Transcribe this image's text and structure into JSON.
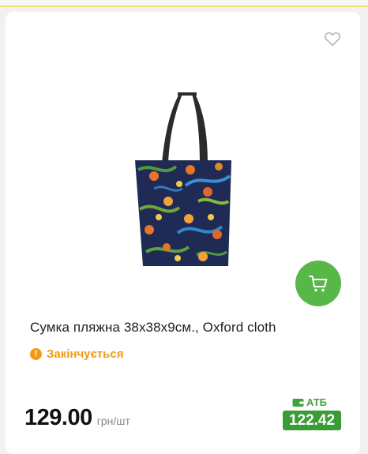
{
  "product": {
    "title": "Сумка пляжна 38х38х9см., Oxford cloth",
    "status": "Закінчується",
    "price": "129.00",
    "price_unit": "грн/шт",
    "card_label": "АТБ",
    "card_price": "122.42"
  },
  "icons": {
    "favorite": "heart-icon",
    "cart": "shopping-cart-icon",
    "status": "exclamation-icon",
    "card": "wallet-icon"
  },
  "colors": {
    "accent_green": "#57b847",
    "card_price_green": "#3a9b37",
    "status_orange": "#f29a16",
    "top_strip_yellow": "#f6dc6b"
  }
}
